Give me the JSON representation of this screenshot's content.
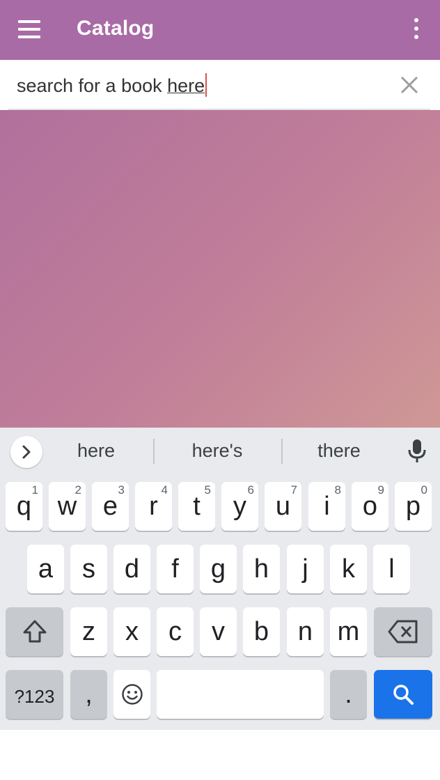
{
  "app_bar": {
    "title": "Catalog",
    "menu_icon": "menu-icon",
    "overflow_icon": "more-vert-icon",
    "color": "#a86ba6"
  },
  "search": {
    "text_prefix": "search for a book ",
    "composing_word": "here",
    "clear_icon": "close-icon"
  },
  "keyboard": {
    "suggestions": [
      "here",
      "here's",
      "there"
    ],
    "expand_icon": "chevron-right-icon",
    "mic_icon": "mic-icon",
    "row1": [
      {
        "label": "q",
        "hint": "1"
      },
      {
        "label": "w",
        "hint": "2"
      },
      {
        "label": "e",
        "hint": "3"
      },
      {
        "label": "r",
        "hint": "4"
      },
      {
        "label": "t",
        "hint": "5"
      },
      {
        "label": "y",
        "hint": "6"
      },
      {
        "label": "u",
        "hint": "7"
      },
      {
        "label": "i",
        "hint": "8"
      },
      {
        "label": "o",
        "hint": "9"
      },
      {
        "label": "p",
        "hint": "0"
      }
    ],
    "row2": [
      "a",
      "s",
      "d",
      "f",
      "g",
      "h",
      "j",
      "k",
      "l"
    ],
    "row3": [
      "z",
      "x",
      "c",
      "v",
      "b",
      "n",
      "m"
    ],
    "shift_icon": "shift-icon",
    "backspace_icon": "backspace-icon",
    "symbols_label": "?123",
    "comma_label": ",",
    "emoji_icon": "emoji-icon",
    "period_label": ".",
    "search_icon": "search-icon",
    "action_color": "#1a73e8"
  }
}
